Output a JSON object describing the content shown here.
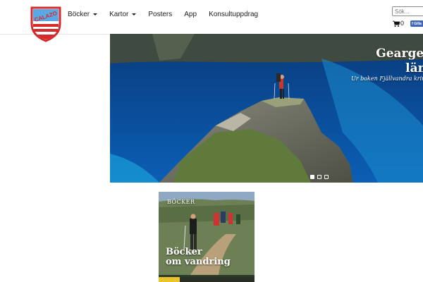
{
  "brand": {
    "logo_text": "CALAZO"
  },
  "nav": {
    "items": [
      {
        "label": "Böcker",
        "dropdown": true
      },
      {
        "label": "Kartor",
        "dropdown": true
      },
      {
        "label": "Posters",
        "dropdown": false
      },
      {
        "label": "App",
        "dropdown": false
      },
      {
        "label": "Konsultuppdrag",
        "dropdown": false
      }
    ]
  },
  "search": {
    "placeholder": "Sök..."
  },
  "cart": {
    "count": "0"
  },
  "facebook": {
    "label": "Gillа"
  },
  "hero": {
    "title": "Geargevág\nlämna",
    "subtitle": "Ur boken Fjällvandra kring K"
  },
  "slider": {
    "slides": 3,
    "active_index": 0
  },
  "featured": {
    "tag": "BÖCKER",
    "title": "Böcker\nom vandring"
  },
  "colors": {
    "accent_red": "#d62a2a",
    "shield_blue": "#1e6fb8",
    "lake_blue": "#0b4fa3"
  }
}
